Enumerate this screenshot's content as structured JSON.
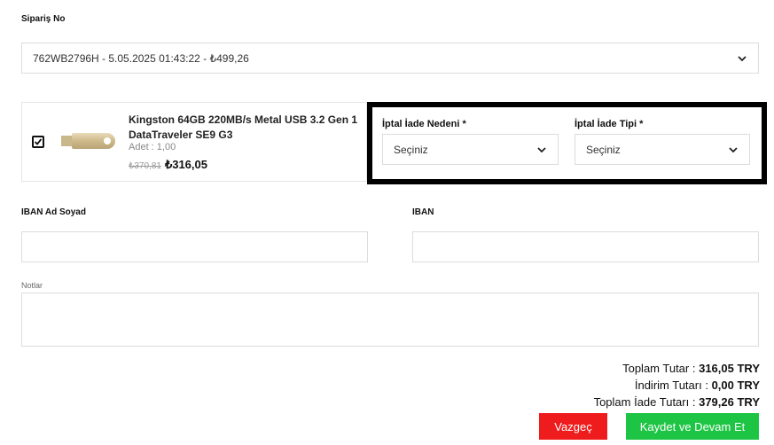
{
  "order": {
    "label": "Sipariş No",
    "selected": "762WB2796H - 5.05.2025 01:43:22 - ₺499,26"
  },
  "product": {
    "title_line1": "Kingston 64GB 220MB/s Metal USB 3.2 Gen 1",
    "title_line2": "DataTraveler SE9 G3",
    "qty": "Adet : 1,00",
    "old_price": "₺370,81",
    "price": "₺316,05",
    "checked": true
  },
  "reason": {
    "label": "İptal İade Nedeni *",
    "selected": "Seçiniz"
  },
  "type": {
    "label": "İptal İade Tipi *",
    "selected": "Seçiniz"
  },
  "iban_name": {
    "label": "IBAN Ad Soyad",
    "value": ""
  },
  "iban": {
    "label": "IBAN",
    "value": ""
  },
  "notes": {
    "label": "Notlar",
    "value": ""
  },
  "totals": {
    "total_label": "Toplam Tutar :",
    "total_value": "316,05 TRY",
    "discount_label": "İndirim Tutarı :",
    "discount_value": "0,00 TRY",
    "refund_label": "Toplam İade Tutarı :",
    "refund_value": "379,26 TRY"
  },
  "buttons": {
    "cancel": "Vazgeç",
    "save": "Kaydet ve Devam Et"
  },
  "colors": {
    "cancel_bg": "#ee1c1c",
    "save_bg": "#1ec545"
  }
}
